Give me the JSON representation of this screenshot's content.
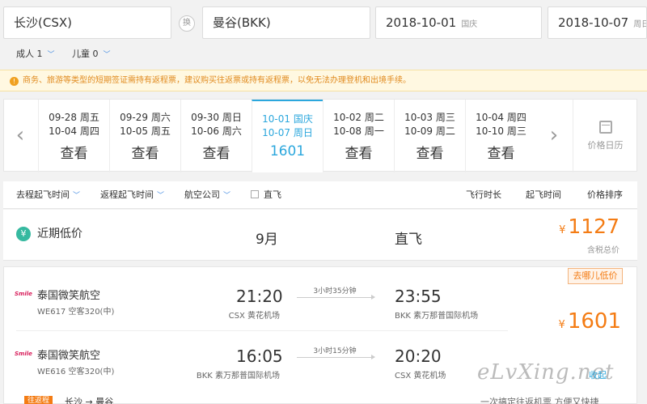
{
  "search": {
    "from": "长沙(CSX)",
    "swap_label": "换",
    "to": "曼谷(BKK)",
    "depart_date": "2018-10-01",
    "depart_note": "国庆",
    "return_date": "2018-10-07",
    "return_note": "周日"
  },
  "passengers": {
    "adult_label": "成人 1",
    "child_label": "儿童 0"
  },
  "notice": {
    "icon": "!",
    "text": "商务、旅游等类型的短期签证需持有返程票，建议购买往返票或持有返程票，以免无法办理登机和出境手续。"
  },
  "date_strip": {
    "prev": "‹",
    "next": "›",
    "cells": [
      {
        "go": "09-28 周五",
        "back": "10-04 周四",
        "price": "查看",
        "active": false
      },
      {
        "go": "09-29 周六",
        "back": "10-05 周五",
        "price": "查看",
        "active": false
      },
      {
        "go": "09-30 周日",
        "back": "10-06 周六",
        "price": "查看",
        "active": false
      },
      {
        "go": "10-01 国庆",
        "back": "10-07 周日",
        "price": "1601",
        "active": true
      },
      {
        "go": "10-02 周二",
        "back": "10-08 周一",
        "price": "查看",
        "active": false
      },
      {
        "go": "10-03 周三",
        "back": "10-09 周二",
        "price": "查看",
        "active": false
      },
      {
        "go": "10-04 周四",
        "back": "10-10 周三",
        "price": "查看",
        "active": false
      }
    ],
    "calendar_label": "价格日历"
  },
  "sort_bar": {
    "outbound_time": "去程起飞时间",
    "return_time": "返程起飞时间",
    "airline": "航空公司",
    "share": "直飞",
    "duration": "飞行时长",
    "departure": "起飞时间",
    "price": "价格排序"
  },
  "low_price": {
    "icon": "¥",
    "label": "近期低价",
    "month": "9月",
    "type": "直飞",
    "currency": "¥",
    "price": "1127",
    "tax_note": "含税总价"
  },
  "flight": {
    "badge": "去哪儿低价",
    "currency": "¥",
    "price": "1601",
    "collapse": "收起",
    "legs": [
      {
        "logo": "Smile",
        "airline": "泰国微笑航空",
        "flight_no": "WE617 空客320(中)",
        "dep_time": "21:20",
        "dep_airport": "CSX 黄花机场",
        "duration": "3小时35分钟",
        "arr_time": "23:55",
        "arr_airport": "BKK 素万那普国际机场"
      },
      {
        "logo": "Smile",
        "airline": "泰国微笑航空",
        "flight_no": "WE616 空客320(中)",
        "dep_time": "16:05",
        "dep_airport": "BKK 素万那普国际机场",
        "duration": "3小时15分钟",
        "arr_time": "20:20",
        "arr_airport": "CSX 黄花机场"
      }
    ]
  },
  "watermark": "eLvXing.net",
  "bottom": {
    "tag": "往返程",
    "route": "长沙 → 曼谷",
    "right": "一次搞定往返机票  方便又快捷"
  }
}
